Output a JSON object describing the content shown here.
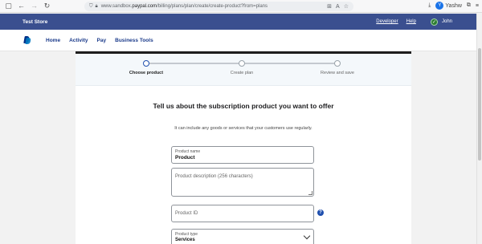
{
  "browser": {
    "url_prefix": "www.sandbox.",
    "url_domain": "paypal.com",
    "url_path": "/billing/plans/plan/create/create-product?from=plans",
    "profile_initial": "Y",
    "profile_name": "Yashw"
  },
  "header": {
    "store_name": "Test Store",
    "developer_label": "Developer",
    "help_label": "Help",
    "user_name": "John"
  },
  "nav": {
    "items": [
      "Home",
      "Activity",
      "Pay",
      "Business Tools"
    ]
  },
  "stepper": {
    "steps": [
      {
        "label": "Choose product",
        "active": true
      },
      {
        "label": "Create plan",
        "active": false
      },
      {
        "label": "Review and save",
        "active": false
      }
    ]
  },
  "form": {
    "title": "Tell us about the subscription product you want to offer",
    "subtitle": "It can include any goods or services that your customers use regularly.",
    "product_name_label": "Product name",
    "product_name_value": "Product",
    "product_description_placeholder": "Product description (256 characters)",
    "product_id_placeholder": "Product ID",
    "help_glyph": "?",
    "product_type_label": "Product type",
    "product_type_value": "Services"
  }
}
